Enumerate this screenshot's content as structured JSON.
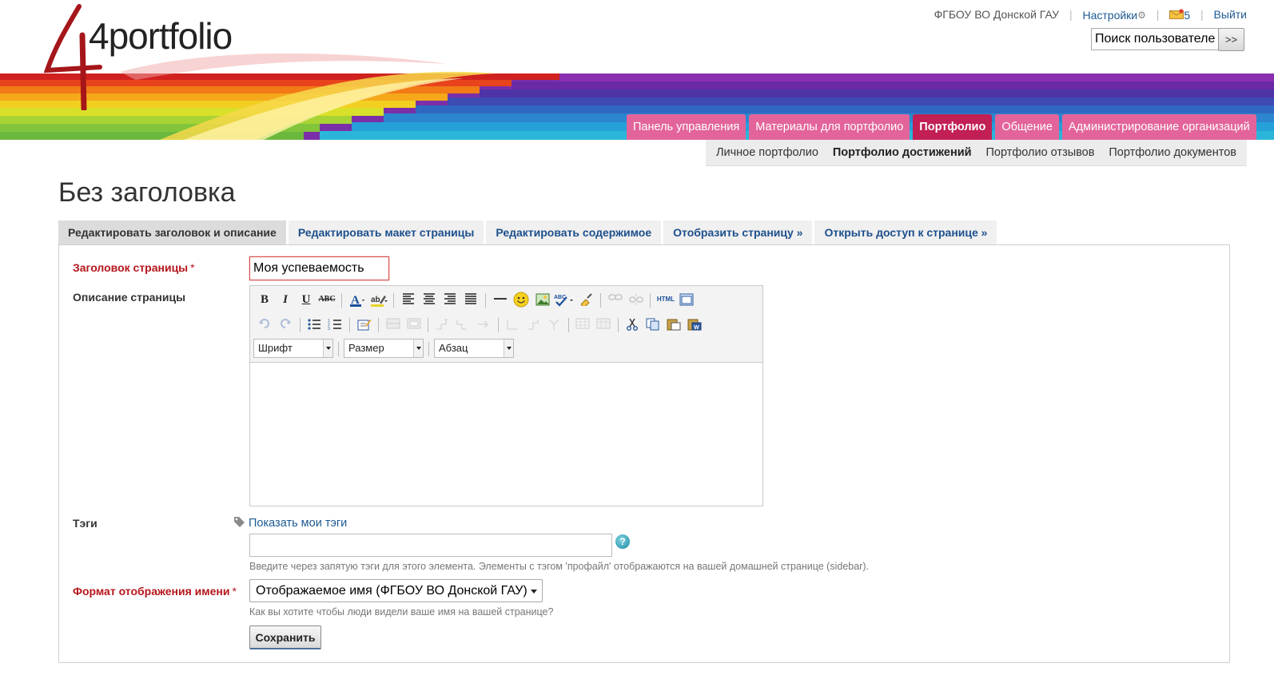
{
  "header": {
    "logo_text": "4portfolio",
    "institution": "ФГБОУ ВО Донской ГАУ",
    "settings_label": "Настройки",
    "messages_count": "5",
    "logout_label": "Выйти",
    "search_placeholder": "Поиск пользователей",
    "search_button": ">>"
  },
  "main_nav": {
    "items": [
      {
        "label": "Панель управления",
        "active": false
      },
      {
        "label": "Материалы для портфолио",
        "active": false
      },
      {
        "label": "Портфолио",
        "active": true
      },
      {
        "label": "Общение",
        "active": false
      },
      {
        "label": "Администрирование организаций",
        "active": false
      }
    ]
  },
  "sub_nav": {
    "items": [
      {
        "label": "Личное портфолио",
        "active": false
      },
      {
        "label": "Портфолио достижений",
        "active": true
      },
      {
        "label": "Портфолио отзывов",
        "active": false
      },
      {
        "label": "Портфолио документов",
        "active": false
      }
    ]
  },
  "page": {
    "title": "Без заголовка",
    "tabs": [
      {
        "label": "Редактировать заголовок и описание",
        "active": true
      },
      {
        "label": "Редактировать макет страницы",
        "active": false
      },
      {
        "label": "Редактировать содержимое",
        "active": false
      },
      {
        "label": "Отобразить страницу »",
        "active": false
      },
      {
        "label": "Открыть доступ к странице »",
        "active": false
      }
    ]
  },
  "form": {
    "title_label": "Заголовок страницы",
    "required_mark": "*",
    "title_value": "Моя успеваемость",
    "description_label": "Описание страницы",
    "editor": {
      "bold": "B",
      "italic": "I",
      "underline": "U",
      "strike": "ABC",
      "html_label": "HTML",
      "font_select": "Шрифт",
      "size_select": "Размер",
      "format_select": "Абзац"
    },
    "tags_label": "Тэги",
    "tags_link": "Показать мои тэги",
    "tags_value": "",
    "tags_hint": "Введите через запятую тэги для этого элемента. Элементы с тэгом 'профайл' отображаются на вашей домашней странице (sidebar).",
    "name_format_label": "Формат отображения имени",
    "name_format_value": "Отображаемое имя (ФГБОУ ВО Донской ГАУ)",
    "name_format_hint": "Как вы хотите чтобы люди видели ваше имя на вашей странице?",
    "save_button": "Сохранить"
  },
  "colors": {
    "nav_tab": "#e3649a",
    "nav_tab_active": "#c21f55",
    "required_label": "#b5161c",
    "link": "#1d5a93"
  }
}
